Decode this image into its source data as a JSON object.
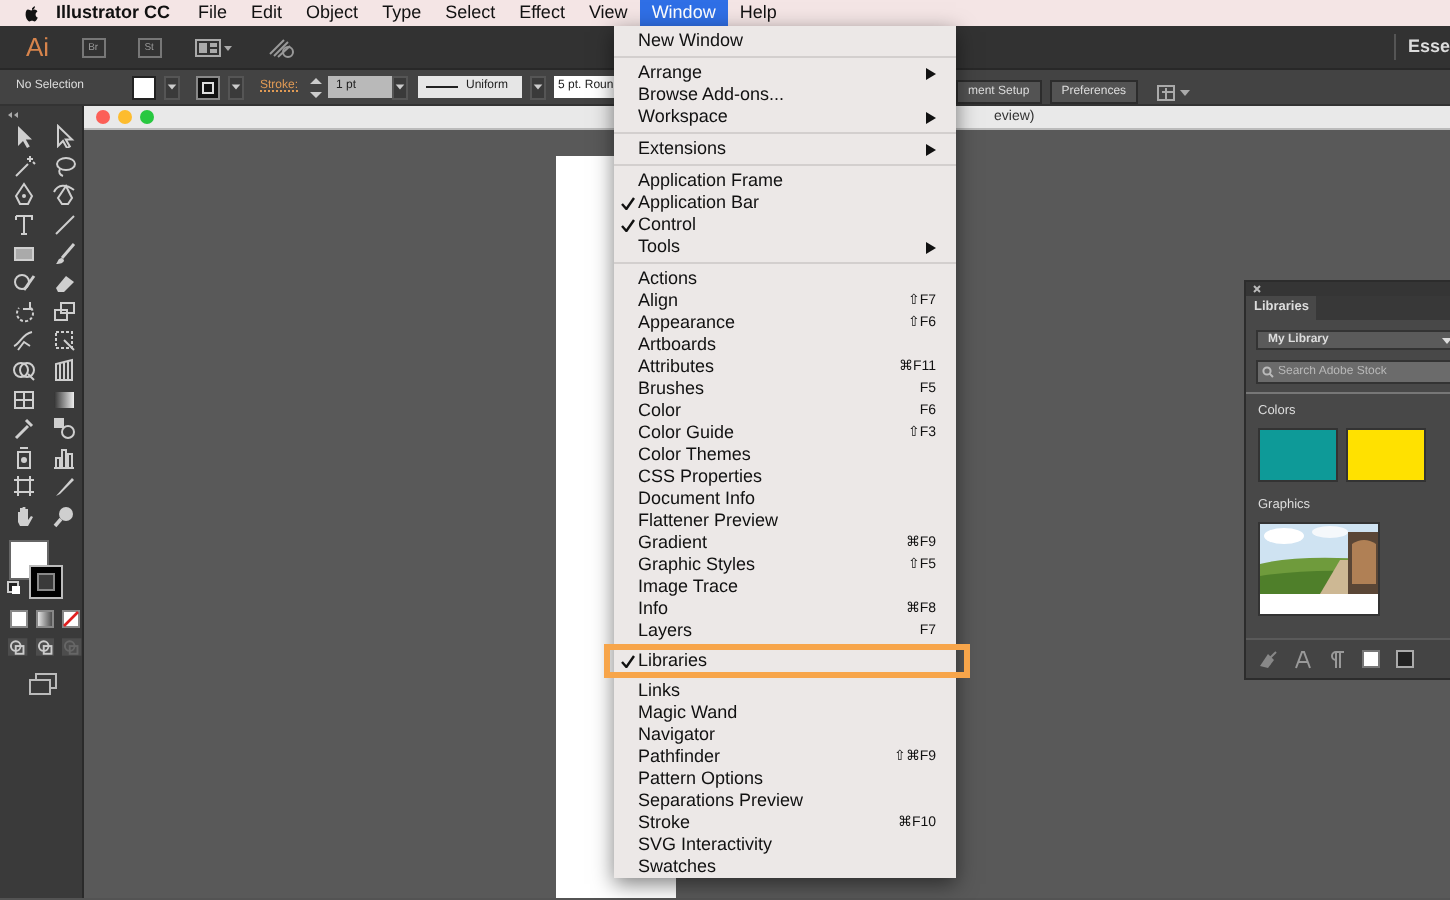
{
  "menubar": {
    "app_name": "Illustrator CC",
    "items": [
      {
        "label": "File",
        "selected": false
      },
      {
        "label": "Edit",
        "selected": false
      },
      {
        "label": "Object",
        "selected": false
      },
      {
        "label": "Type",
        "selected": false
      },
      {
        "label": "Select",
        "selected": false
      },
      {
        "label": "Effect",
        "selected": false
      },
      {
        "label": "View",
        "selected": false
      },
      {
        "label": "Window",
        "selected": true
      },
      {
        "label": "Help",
        "selected": false
      }
    ]
  },
  "app_bar": {
    "logo": "Ai",
    "apps": [
      "Br",
      "St"
    ],
    "workspace": "Esse"
  },
  "control_bar": {
    "selection": "No Selection",
    "stroke_label": "Stroke:",
    "stroke_weight": "1 pt",
    "profile": "Uniform",
    "brush": "5 pt. Roun",
    "buttons": [
      "ment Setup",
      "Preferences"
    ]
  },
  "document": {
    "title": "eview)"
  },
  "window_menu": {
    "groups": [
      {
        "items": [
          {
            "label": "New Window",
            "checked": false,
            "submenu": false,
            "highlighted": false
          }
        ]
      },
      {
        "items": [
          {
            "label": "Arrange",
            "checked": false,
            "submenu": true,
            "highlighted": false
          },
          {
            "label": "Browse Add-ons...",
            "checked": false,
            "submenu": false,
            "highlighted": false
          },
          {
            "label": "Workspace",
            "checked": false,
            "submenu": true,
            "highlighted": false
          }
        ]
      },
      {
        "items": [
          {
            "label": "Extensions",
            "checked": false,
            "submenu": true,
            "highlighted": false
          }
        ]
      },
      {
        "items": [
          {
            "label": "Application Frame",
            "checked": false,
            "submenu": false,
            "highlighted": false
          },
          {
            "label": "Application Bar",
            "checked": true,
            "submenu": false,
            "highlighted": false
          },
          {
            "label": "Control",
            "checked": true,
            "submenu": false,
            "highlighted": false
          },
          {
            "label": "Tools",
            "checked": false,
            "submenu": true,
            "highlighted": false
          }
        ]
      },
      {
        "items": [
          {
            "label": "Actions",
            "checked": false,
            "submenu": false,
            "highlighted": false
          },
          {
            "label": "Align",
            "shortcut": "⇧F7",
            "checked": false,
            "submenu": false,
            "highlighted": false
          },
          {
            "label": "Appearance",
            "shortcut": "⇧F6",
            "checked": false,
            "submenu": false,
            "highlighted": false
          },
          {
            "label": "Artboards",
            "checked": false,
            "submenu": false,
            "highlighted": false
          },
          {
            "label": "Attributes",
            "shortcut": "⌘F11",
            "checked": false,
            "submenu": false,
            "highlighted": false
          },
          {
            "label": "Brushes",
            "shortcut": "F5",
            "checked": false,
            "submenu": false,
            "highlighted": false
          },
          {
            "label": "Color",
            "shortcut": "F6",
            "checked": false,
            "submenu": false,
            "highlighted": false
          },
          {
            "label": "Color Guide",
            "shortcut": "⇧F3",
            "checked": false,
            "submenu": false,
            "highlighted": false
          },
          {
            "label": "Color Themes",
            "checked": false,
            "submenu": false,
            "highlighted": false
          },
          {
            "label": "CSS Properties",
            "checked": false,
            "submenu": false,
            "highlighted": false
          },
          {
            "label": "Document Info",
            "checked": false,
            "submenu": false,
            "highlighted": false
          },
          {
            "label": "Flattener Preview",
            "checked": false,
            "submenu": false,
            "highlighted": false
          },
          {
            "label": "Gradient",
            "shortcut": "⌘F9",
            "checked": false,
            "submenu": false,
            "highlighted": false
          },
          {
            "label": "Graphic Styles",
            "shortcut": "⇧F5",
            "checked": false,
            "submenu": false,
            "highlighted": false
          },
          {
            "label": "Image Trace",
            "checked": false,
            "submenu": false,
            "highlighted": false
          },
          {
            "label": "Info",
            "shortcut": "⌘F8",
            "checked": false,
            "submenu": false,
            "highlighted": false
          },
          {
            "label": "Layers",
            "shortcut": "F7",
            "checked": false,
            "submenu": false,
            "highlighted": false
          },
          {
            "label": "Libraries",
            "checked": true,
            "submenu": false,
            "highlighted": true
          },
          {
            "label": "Links",
            "checked": false,
            "submenu": false,
            "highlighted": false
          },
          {
            "label": "Magic Wand",
            "checked": false,
            "submenu": false,
            "highlighted": false
          },
          {
            "label": "Navigator",
            "checked": false,
            "submenu": false,
            "highlighted": false
          },
          {
            "label": "Pathfinder",
            "shortcut": "⇧⌘F9",
            "checked": false,
            "submenu": false,
            "highlighted": false
          },
          {
            "label": "Pattern Options",
            "checked": false,
            "submenu": false,
            "highlighted": false
          },
          {
            "label": "Separations Preview",
            "checked": false,
            "submenu": false,
            "highlighted": false
          },
          {
            "label": "Stroke",
            "shortcut": "⌘F10",
            "checked": false,
            "submenu": false,
            "highlighted": false
          },
          {
            "label": "SVG Interactivity",
            "checked": false,
            "submenu": false,
            "highlighted": false
          },
          {
            "label": "Swatches",
            "checked": false,
            "submenu": false,
            "highlighted": false
          }
        ]
      }
    ]
  },
  "libraries_panel": {
    "tab": "Libraries",
    "library": "My Library",
    "search": {
      "placeholder": "Search Adobe Stock"
    },
    "colors_heading": "Colors",
    "colors": [
      {
        "color": "#0e9a98"
      },
      {
        "color": "#ffe100"
      }
    ],
    "graphics_heading": "Graphics"
  }
}
